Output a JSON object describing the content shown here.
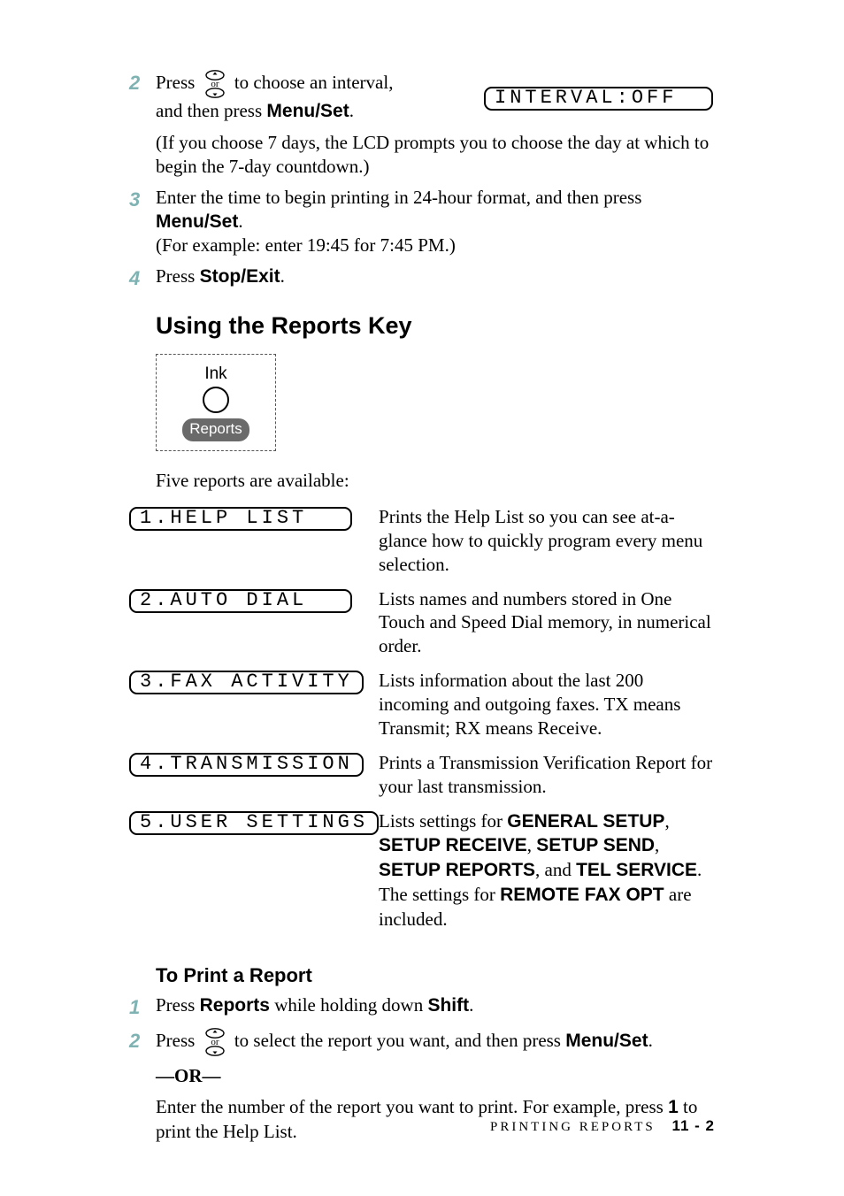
{
  "lcd_top": "INTERVAL:OFF",
  "steps_top": {
    "s2": {
      "line1a": "Press ",
      "line1b": " to choose an interval,",
      "line2a": "and then press ",
      "menu_set": "Menu/Set",
      "line2c": ".",
      "p2": "(If you choose 7 days, the LCD prompts you to choose the day at which to begin the 7-day countdown.)"
    },
    "s3": {
      "a": "Enter the time to begin printing in 24-hour format, and then press ",
      "menu_set": "Menu/Set",
      "c": ".",
      "d": "(For example: enter 19:45 for 7:45 PM.)"
    },
    "s4": {
      "a": "Press ",
      "stop_exit": "Stop/Exit",
      "c": "."
    }
  },
  "section_title": "Using the Reports Key",
  "keybox": {
    "ink": "Ink",
    "reports": "Reports"
  },
  "reports_intro": "Five reports are available:",
  "report_items": [
    {
      "lcd": "1.HELP LIST",
      "desc": "Prints the Help List so you can see at-a-glance how to quickly program every menu selection."
    },
    {
      "lcd": "2.AUTO DIAL",
      "desc": "Lists names and numbers stored in One Touch and Speed Dial memory, in numerical order."
    },
    {
      "lcd": "3.FAX ACTIVITY",
      "desc": "Lists information about the last 200 incoming and outgoing faxes. TX means Transmit; RX means Receive."
    },
    {
      "lcd": "4.TRANSMISSION",
      "desc": "Prints a Transmission Verification Report for your last transmission."
    },
    {
      "lcd": "5.USER SETTINGS",
      "desc_prefix": "Lists settings for ",
      "desc_bold_segments": [
        "GENERAL SETUP",
        "SETUP RECEIVE",
        "SETUP SEND",
        "SETUP REPORTS",
        "TEL SERVICE",
        "REMOTE FAX OPT"
      ],
      "desc_joins": [
        ", ",
        ", ",
        ", ",
        ", and ",
        ". The settings for ",
        " are included."
      ]
    }
  ],
  "subsection_title": "To Print a Report",
  "steps_bottom": {
    "s1": {
      "a": "Press ",
      "reports": "Reports",
      "b": " while holding down ",
      "shift": "Shift",
      "c": "."
    },
    "s2": {
      "a": "Press ",
      "b": " to select the report you want, and then press ",
      "menu_set": "Menu/Set",
      "c": ".",
      "or": "—OR—",
      "d": "Enter the number of the report you want to print. For example, press ",
      "one": "1",
      "e": " to print the Help List."
    }
  },
  "footer": {
    "label": "PRINTING REPORTS",
    "page": "11 - 2"
  }
}
